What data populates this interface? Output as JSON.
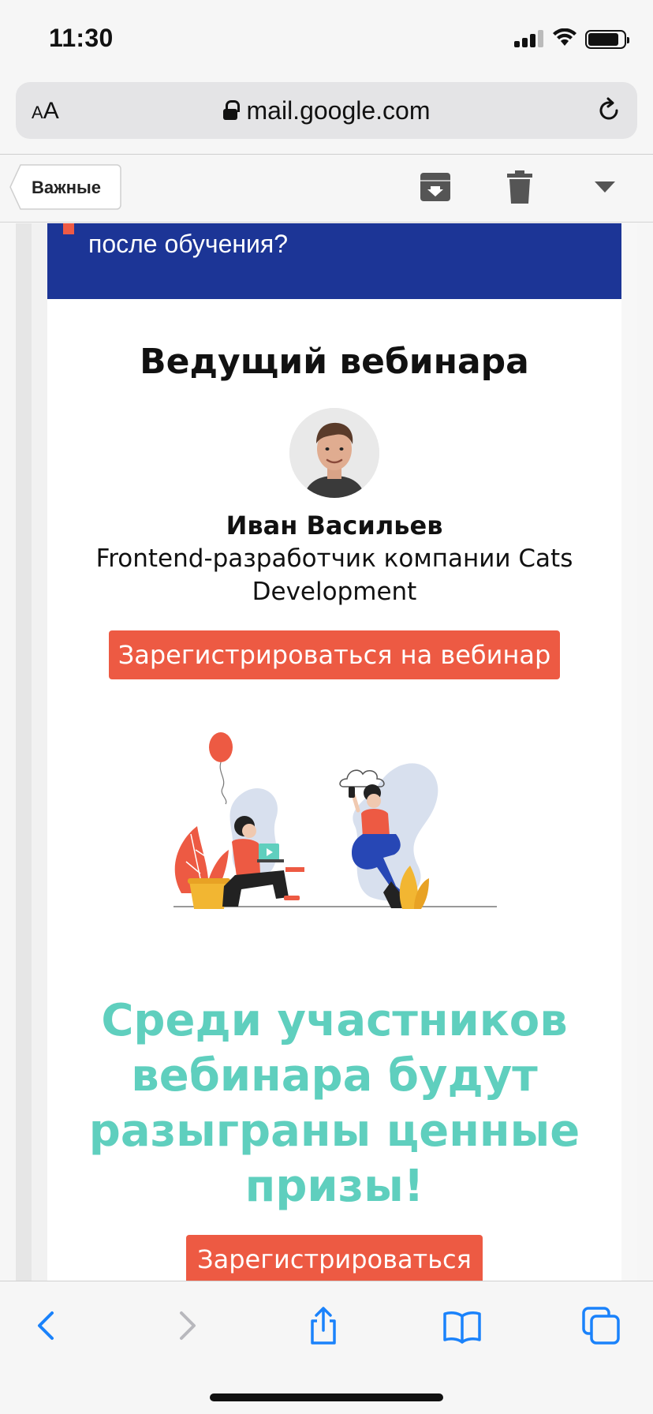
{
  "status_bar": {
    "time": "11:30"
  },
  "browser": {
    "text_size_small": "A",
    "text_size_large": "A",
    "url": "mail.google.com"
  },
  "gmail_toolbar": {
    "back_label": "Важные"
  },
  "email": {
    "banner_text": "после обучения?",
    "host_heading": "Ведущий вебинара",
    "host_name": "Иван Васильев",
    "host_role": "Frontend-разработчик компании Cats Development",
    "register_webinar_label": "Зарегистрироваться на вебинар",
    "prizes_text": "Среди участников вебинара будут разыграны ценные призы!",
    "register_label": "Зарегистрироваться"
  },
  "colors": {
    "banner_blue": "#1c3596",
    "button_red": "#ed5a43",
    "prize_teal": "#5fcfbe",
    "ios_blue": "#1a82fb"
  }
}
